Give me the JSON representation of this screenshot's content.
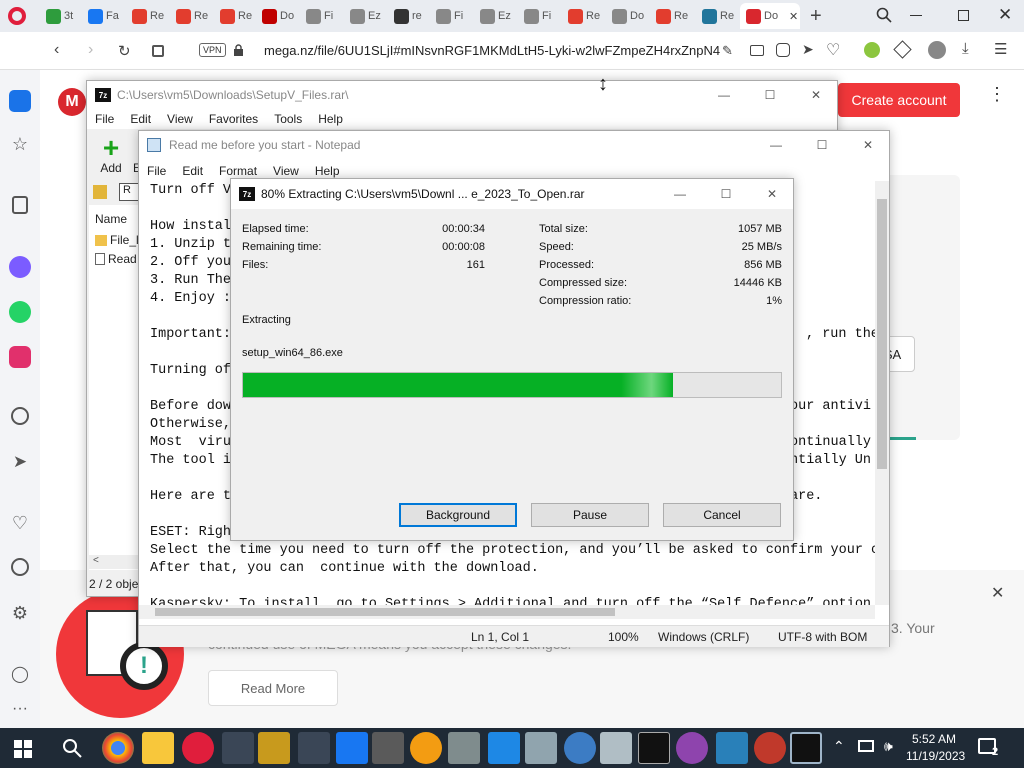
{
  "browser": {
    "tabs": [
      {
        "label": "3t",
        "color": "#2e9c3d"
      },
      {
        "label": "Fa",
        "color": "#1877f2"
      },
      {
        "label": "Re",
        "color": "#e23d2e"
      },
      {
        "label": "Re",
        "color": "#e23d2e"
      },
      {
        "label": "Re",
        "color": "#e23d2e"
      },
      {
        "label": "Do",
        "color": "#c00000"
      },
      {
        "label": "Fi",
        "color": "#888888"
      },
      {
        "label": "Ez",
        "color": "#888888"
      },
      {
        "label": "re",
        "color": "#333333"
      },
      {
        "label": "Fi",
        "color": "#888888"
      },
      {
        "label": "Ez",
        "color": "#888888"
      },
      {
        "label": "Fi",
        "color": "#888888"
      },
      {
        "label": "Re",
        "color": "#e23d2e"
      },
      {
        "label": "Do",
        "color": "#888888"
      },
      {
        "label": "Re",
        "color": "#e23d2e"
      },
      {
        "label": "Re",
        "color": "#21759b"
      },
      {
        "label": "Do",
        "color": "#d9272e"
      }
    ],
    "vpn": "VPN",
    "url": "mega.nz/file/6UU1SLjI#mINsvnRGF1MKMdLtH5-Lyki-w2lwFZmpeZH4rxZnpN4"
  },
  "mega": {
    "logo": "M",
    "create_account": "Create account",
    "cookie_text_right": "3. Your",
    "cookie_text_partial": "continued use of MEGA means you accept these changes.",
    "read_more": "Read More",
    "side_btn": "SA"
  },
  "sevenzip_fm": {
    "title": "C:\\Users\\vm5\\Downloads\\SetupV_Files.rar\\",
    "menu": [
      "File",
      "Edit",
      "View",
      "Favorites",
      "Tools",
      "Help"
    ],
    "add_label": "Add",
    "add_label2": "E",
    "col_name": "Name",
    "files": [
      "File_l",
      "Read"
    ],
    "status": "2 / 2 obje"
  },
  "notepad": {
    "title": "Read me before you start - Notepad",
    "menu": [
      "File",
      "Edit",
      "Format",
      "View",
      "Help"
    ],
    "lines": [
      "Turn off V",
      "",
      "How instal",
      "1. Unzip t",
      "2. Off you",
      "3. Run The",
      "4. Enjoy :",
      "",
      "Important:",
      "",
      "Turning of",
      "",
      "Before dow",
      "Otherwise,",
      "Most  viru",
      "The tool i",
      "",
      "Here are t",
      "",
      "ESET: Righ",
      "Select the time you need to turn off the protection, and you’ll be asked to confirm your c",
      "After that, you can  continue with the download.",
      "",
      "Kaspersky: To install, go to Settings > Additional and turn off the “Self Defence” option"
    ],
    "right_frags": [
      ", run the",
      "our antivi",
      "ontinually",
      "ntially Un",
      "are."
    ],
    "status": {
      "pos": "Ln 1, Col 1",
      "zoom": "100%",
      "eol": "Windows (CRLF)",
      "enc": "UTF-8 with BOM"
    }
  },
  "extract": {
    "title": "80% Extracting C:\\Users\\vm5\\Downl ... e_2023_To_Open.rar",
    "elapsed_label": "Elapsed time:",
    "elapsed": "00:00:34",
    "remaining_label": "Remaining time:",
    "remaining": "00:00:08",
    "files_label": "Files:",
    "files": "161",
    "total_label": "Total size:",
    "total": "1057 MB",
    "speed_label": "Speed:",
    "speed": "25 MB/s",
    "processed_label": "Processed:",
    "processed": "856 MB",
    "compressed_label": "Compressed size:",
    "compressed": "14446 KB",
    "ratio_label": "Compression ratio:",
    "ratio": "1%",
    "status": "Extracting",
    "current_file": "setup_win64_86.exe",
    "progress": 0.8,
    "buttons": {
      "background": "Background",
      "pause": "Pause",
      "cancel": "Cancel"
    }
  },
  "taskbar": {
    "time": "5:52 AM",
    "date": "11/19/2023",
    "notif_count": "2"
  }
}
